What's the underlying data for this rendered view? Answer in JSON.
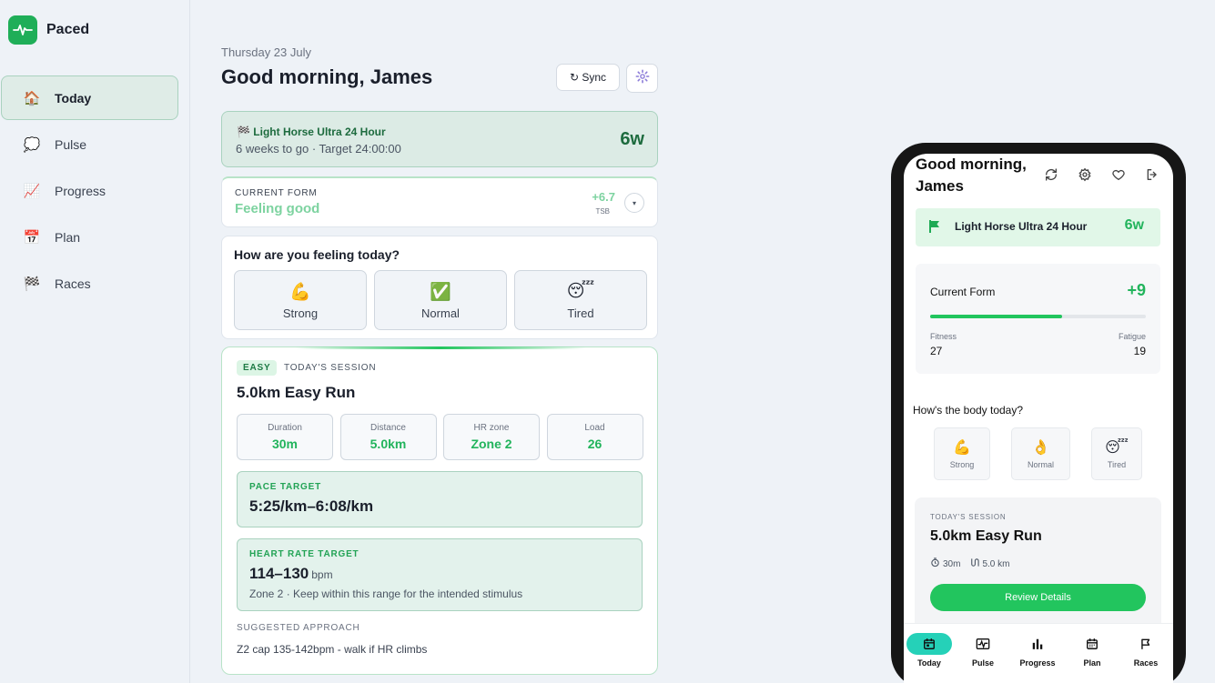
{
  "app": {
    "name": "Paced"
  },
  "sidebar": {
    "items": [
      {
        "label": "Today",
        "icon": "🏠",
        "icon_name": "house-icon",
        "active": true
      },
      {
        "label": "Pulse",
        "icon": "💭",
        "icon_name": "thought-bubble-icon",
        "active": false
      },
      {
        "label": "Progress",
        "icon": "📈",
        "icon_name": "chart-up-icon",
        "active": false
      },
      {
        "label": "Plan",
        "icon": "📅",
        "icon_name": "calendar-icon",
        "active": false
      },
      {
        "label": "Races",
        "icon": "🏁",
        "icon_name": "checkered-flag-icon",
        "active": false
      }
    ]
  },
  "header": {
    "date": "Thursday 23 July",
    "greeting": "Good morning, James",
    "sync_label": "↻ Sync"
  },
  "race": {
    "icon": "🏁",
    "name": "Light Horse Ultra 24 Hour",
    "meta": "6 weeks to go · Target 24:00:00",
    "weeks": "6w"
  },
  "form": {
    "label": "CURRENT FORM",
    "status": "Feeling good",
    "value": "+6.7",
    "unit": "TSB",
    "toggle": "▾"
  },
  "feeling": {
    "question": "How are you feeling today?",
    "options": [
      {
        "emoji": "💪",
        "label": "Strong"
      },
      {
        "emoji": "✅",
        "label": "Normal"
      },
      {
        "emoji": "😴",
        "label": "Tired"
      }
    ]
  },
  "session": {
    "badge": "EASY",
    "tag": "TODAY'S SESSION",
    "title": "5.0km Easy Run",
    "stats": [
      {
        "label": "Duration",
        "value": "30m"
      },
      {
        "label": "Distance",
        "value": "5.0km"
      },
      {
        "label": "HR zone",
        "value": "Zone 2"
      },
      {
        "label": "Load",
        "value": "26"
      }
    ],
    "pace": {
      "label": "PACE TARGET",
      "value": "5:25/km–6:08/km"
    },
    "hr": {
      "label": "HEART RATE TARGET",
      "value": "114–130",
      "unit": "bpm",
      "note": "Zone 2 · Keep within this range for the intended stimulus"
    },
    "approach": {
      "label": "SUGGESTED APPROACH",
      "text": "Z2 cap 135-142bpm - walk if HR climbs"
    }
  },
  "phone": {
    "greeting_line1": "Good morning,",
    "greeting_line2": "James",
    "race": {
      "name": "Light Horse Ultra 24 Hour",
      "weeks": "6w"
    },
    "form": {
      "title": "Current Form",
      "value": "+9",
      "progress": 0.61,
      "fitness_label": "Fitness",
      "fitness": "27",
      "fatigue_label": "Fatigue",
      "fatigue": "19"
    },
    "body_question": "How's the body today?",
    "options": [
      {
        "emoji": "💪",
        "label": "Strong"
      },
      {
        "emoji": "👌",
        "label": "Normal"
      },
      {
        "emoji": "😴",
        "label": "Tired"
      }
    ],
    "session": {
      "tag": "TODAY'S SESSION",
      "title": "5.0km Easy Run",
      "duration": "30m",
      "distance": "5.0 km",
      "button": "Review Details"
    },
    "tabs": [
      {
        "label": "Today",
        "active": true
      },
      {
        "label": "Pulse",
        "active": false
      },
      {
        "label": "Progress",
        "active": false
      },
      {
        "label": "Plan",
        "active": false
      },
      {
        "label": "Races",
        "active": false
      }
    ]
  },
  "colors": {
    "brand": "#1fae58",
    "accent": "#22c55e",
    "active_tab": "#25d1b8"
  }
}
